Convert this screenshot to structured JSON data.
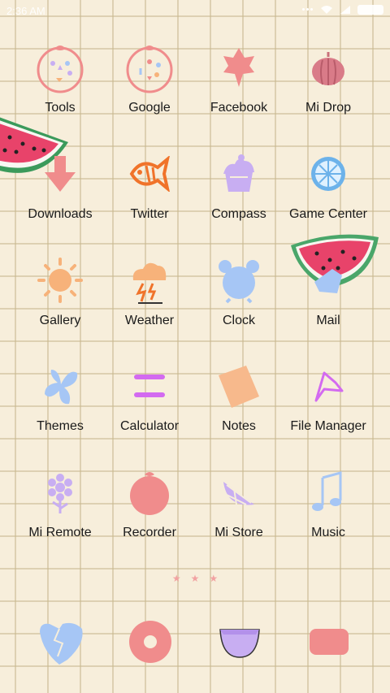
{
  "status_bar": {
    "time": "2:36 AM"
  },
  "apps": [
    {
      "label": "Tools",
      "icon": "tools-icon"
    },
    {
      "label": "Google",
      "icon": "google-icon"
    },
    {
      "label": "Facebook",
      "icon": "facebook-icon"
    },
    {
      "label": "Mi Drop",
      "icon": "mi-drop-icon"
    },
    {
      "label": "Downloads",
      "icon": "downloads-icon"
    },
    {
      "label": "Twitter",
      "icon": "twitter-icon"
    },
    {
      "label": "Compass",
      "icon": "compass-icon"
    },
    {
      "label": "Game Center",
      "icon": "game-center-icon"
    },
    {
      "label": "Gallery",
      "icon": "gallery-icon"
    },
    {
      "label": "Weather",
      "icon": "weather-icon"
    },
    {
      "label": "Clock",
      "icon": "clock-icon"
    },
    {
      "label": "Mail",
      "icon": "mail-icon"
    },
    {
      "label": "Themes",
      "icon": "themes-icon"
    },
    {
      "label": "Calculator",
      "icon": "calculator-icon"
    },
    {
      "label": "Notes",
      "icon": "notes-icon"
    },
    {
      "label": "File Manager",
      "icon": "file-manager-icon"
    },
    {
      "label": "Mi Remote",
      "icon": "mi-remote-icon"
    },
    {
      "label": "Recorder",
      "icon": "recorder-icon"
    },
    {
      "label": "Mi Store",
      "icon": "mi-store-icon"
    },
    {
      "label": "Music",
      "icon": "music-icon"
    }
  ],
  "dock": [
    {
      "icon": "phone-icon"
    },
    {
      "icon": "messaging-icon"
    },
    {
      "icon": "browser-icon"
    },
    {
      "icon": "camera-icon"
    }
  ],
  "colors": {
    "background": "#f7eedb",
    "grid_line": "#c9b88f",
    "pink": "#f08c8c",
    "blue": "#a6c6f5",
    "purple": "#c8aef2",
    "orange": "#f7b27a",
    "label": "#1a1a1a"
  }
}
